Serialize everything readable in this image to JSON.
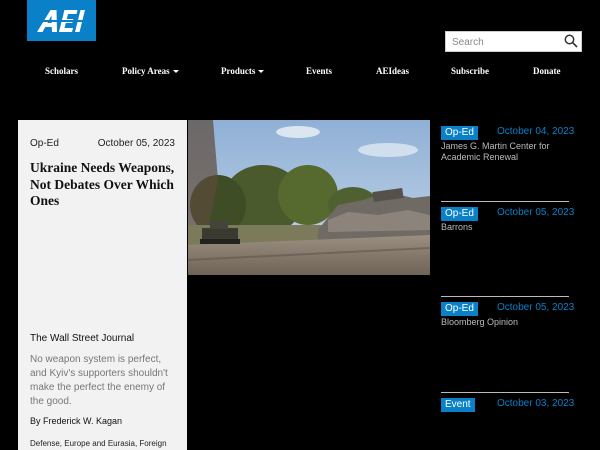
{
  "brand": {
    "logo_text": "AEI",
    "accent": "#0a80c8"
  },
  "search": {
    "placeholder": "Search",
    "icon": "search-icon"
  },
  "nav": {
    "items": [
      {
        "label": "Scholars",
        "has_dropdown": false
      },
      {
        "label": "Policy Areas",
        "has_dropdown": true
      },
      {
        "label": "Products",
        "has_dropdown": true
      },
      {
        "label": "Events",
        "has_dropdown": false
      },
      {
        "label": "AEIdeas",
        "has_dropdown": false
      },
      {
        "label": "Subscribe",
        "has_dropdown": false
      },
      {
        "label": "Donate",
        "has_dropdown": false
      }
    ]
  },
  "featured": {
    "type": "Op-Ed",
    "date": "October 05, 2023",
    "headline": "Ukraine Needs Weapons, Not Debates Over Which Ones",
    "publication": "The Wall Street Journal",
    "summary": "No weapon system is perfect, and Kyiv's supporters shouldn't make the perfect the enemy of the good.",
    "author": "By Frederick W. Kagan",
    "topics": "Defense, Europe and Eurasia, Foreign and Defense Policy"
  },
  "feed": [
    {
      "type": "Op-Ed",
      "date": "October 04, 2023",
      "source": "James G. Martin Center for Academic Renewal"
    },
    {
      "type": "Op-Ed",
      "date": "October 05, 2023",
      "source": "Barrons"
    },
    {
      "type": "Op-Ed",
      "date": "October 05, 2023",
      "source": "Bloomberg Opinion"
    },
    {
      "type": "Event",
      "date": "October 03, 2023",
      "source": ""
    }
  ]
}
